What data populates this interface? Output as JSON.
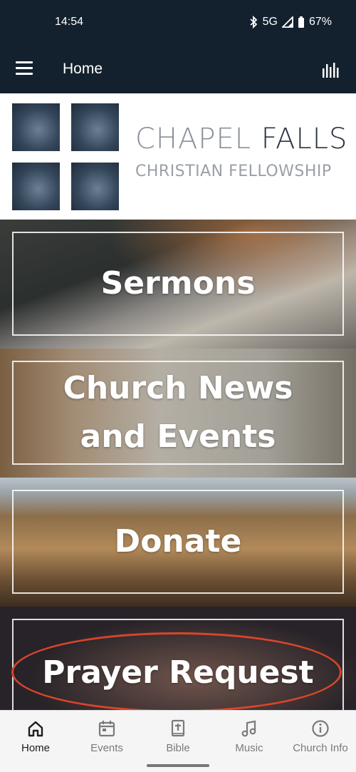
{
  "status_bar": {
    "time": "14:54",
    "network": "5G",
    "battery": "67%"
  },
  "app_bar": {
    "title": "Home",
    "menu_icon": "hamburger-menu-icon",
    "audio_icon": "audio-bars-icon"
  },
  "logo": {
    "line1_light": "CHAPEL ",
    "line1_dark": "FALLS",
    "line2": "CHRISTIAN FELLOWSHIP"
  },
  "tiles": [
    {
      "label": "Sermons"
    },
    {
      "label_line1": "Church News",
      "label_line2": "and Events"
    },
    {
      "label": "Donate"
    },
    {
      "label": "Prayer Request"
    }
  ],
  "bottom_nav": {
    "items": [
      {
        "label": "Home",
        "icon": "home-icon",
        "active": true
      },
      {
        "label": "Events",
        "icon": "calendar-icon",
        "active": false
      },
      {
        "label": "Bible",
        "icon": "bible-icon",
        "active": false
      },
      {
        "label": "Music",
        "icon": "music-note-icon",
        "active": false
      },
      {
        "label": "Church Info",
        "icon": "info-icon",
        "active": false
      }
    ]
  },
  "colors": {
    "header_bg": "#13212e",
    "highlight": "#d8452b"
  }
}
